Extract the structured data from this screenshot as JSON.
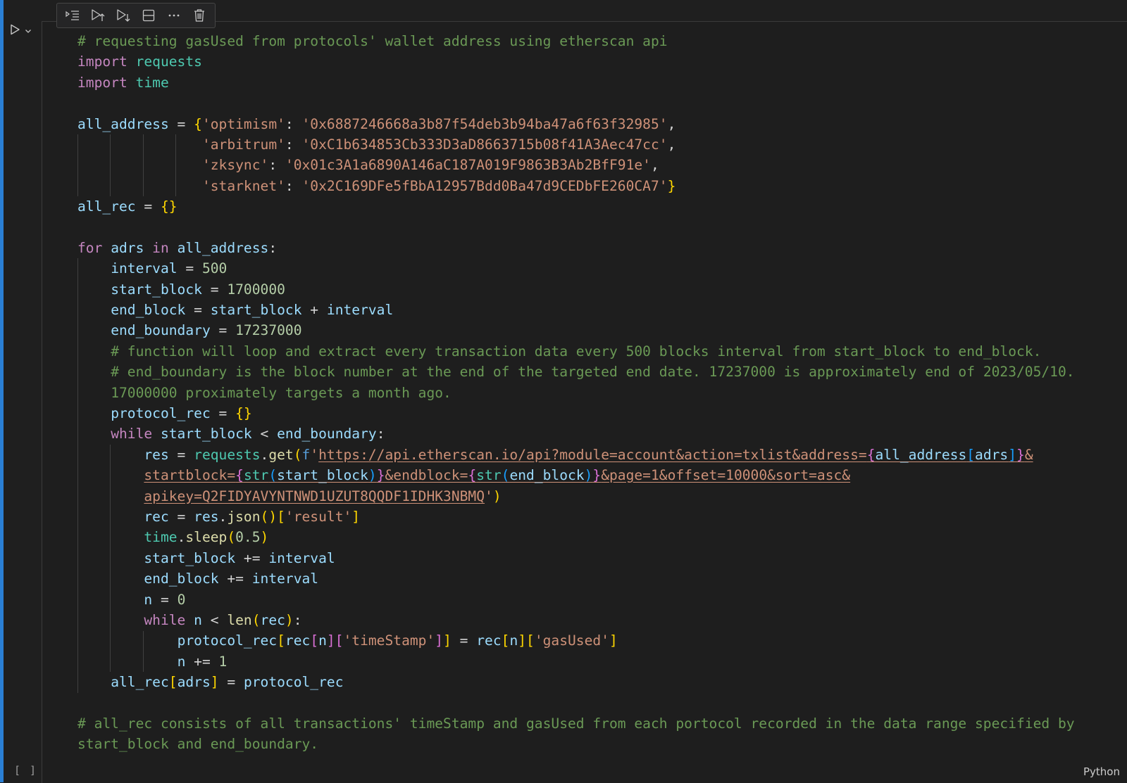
{
  "language": "Python",
  "execution_count": "[ ]",
  "colors": {
    "accent_bar": "#2a7fd4",
    "comment": "#6a9955",
    "keyword": "#c586c0",
    "string": "#ce9178",
    "variable": "#9cdcfe"
  },
  "toolbar": {
    "icons": [
      "execute-above-cells-icon",
      "execute-cell-and-below-icon",
      "run-below-icon",
      "split-cell-icon",
      "more-actions-icon",
      "delete-cell-icon"
    ]
  },
  "code_lines": [
    [
      [
        "cm",
        "# requesting gasUsed from protocols' wallet address using etherscan api"
      ]
    ],
    [
      [
        "kw",
        "import"
      ],
      [
        "op",
        " "
      ],
      [
        "mod",
        "requests"
      ]
    ],
    [
      [
        "kw",
        "import"
      ],
      [
        "op",
        " "
      ],
      [
        "mod",
        "time"
      ]
    ],
    [
      [
        "op",
        ""
      ]
    ],
    [
      [
        "var",
        "all_address"
      ],
      [
        "op",
        " = "
      ],
      [
        "b1",
        "{"
      ],
      [
        "str",
        "'optimism'"
      ],
      [
        "op",
        ": "
      ],
      [
        "str",
        "'0x6887246668a3b87f54deb3b94ba47a6f63f32985'"
      ],
      [
        "op",
        ","
      ]
    ],
    [
      [
        "op",
        "               "
      ],
      [
        "str",
        "'arbitrum'"
      ],
      [
        "op",
        ": "
      ],
      [
        "str",
        "'0xC1b634853Cb333D3aD8663715b08f41A3Aec47cc'"
      ],
      [
        "op",
        ","
      ]
    ],
    [
      [
        "op",
        "               "
      ],
      [
        "str",
        "'zksync'"
      ],
      [
        "op",
        ": "
      ],
      [
        "str",
        "'0x01c3A1a6890A146aC187A019F9863B3Ab2BfF91e'"
      ],
      [
        "op",
        ","
      ]
    ],
    [
      [
        "op",
        "               "
      ],
      [
        "str",
        "'starknet'"
      ],
      [
        "op",
        ": "
      ],
      [
        "str",
        "'0x2C169DFe5fBbA12957Bdd0Ba47d9CEDbFE260CA7'"
      ],
      [
        "b1",
        "}"
      ]
    ],
    [
      [
        "var",
        "all_rec"
      ],
      [
        "op",
        " = "
      ],
      [
        "b1",
        "{}"
      ]
    ],
    [
      [
        "op",
        ""
      ]
    ],
    [
      [
        "kw",
        "for"
      ],
      [
        "op",
        " "
      ],
      [
        "var",
        "adrs"
      ],
      [
        "op",
        " "
      ],
      [
        "kw",
        "in"
      ],
      [
        "op",
        " "
      ],
      [
        "var",
        "all_address"
      ],
      [
        "op",
        ":"
      ]
    ],
    [
      [
        "op",
        "    "
      ],
      [
        "var",
        "interval"
      ],
      [
        "op",
        " = "
      ],
      [
        "num",
        "500"
      ]
    ],
    [
      [
        "op",
        "    "
      ],
      [
        "var",
        "start_block"
      ],
      [
        "op",
        " = "
      ],
      [
        "num",
        "1700000"
      ]
    ],
    [
      [
        "op",
        "    "
      ],
      [
        "var",
        "end_block"
      ],
      [
        "op",
        " = "
      ],
      [
        "var",
        "start_block"
      ],
      [
        "op",
        " + "
      ],
      [
        "var",
        "interval"
      ]
    ],
    [
      [
        "op",
        "    "
      ],
      [
        "var",
        "end_boundary"
      ],
      [
        "op",
        " = "
      ],
      [
        "num",
        "17237000"
      ]
    ],
    [
      [
        "op",
        "    "
      ],
      [
        "cm",
        "# function will loop and extract every transaction data every 500 blocks interval from start_block to end_block."
      ]
    ],
    [
      [
        "op",
        "    "
      ],
      [
        "cm",
        "# end_boundary is the block number at the end of the targeted end date. 17237000 is approximately end of 2023/05/10."
      ]
    ],
    [
      [
        "op",
        "    "
      ],
      [
        "cm",
        "17000000 proximately targets a month ago."
      ]
    ],
    [
      [
        "op",
        "    "
      ],
      [
        "var",
        "protocol_rec"
      ],
      [
        "op",
        " = "
      ],
      [
        "b1",
        "{}"
      ]
    ],
    [
      [
        "op",
        "    "
      ],
      [
        "kw",
        "while"
      ],
      [
        "op",
        " "
      ],
      [
        "var",
        "start_block"
      ],
      [
        "op",
        " < "
      ],
      [
        "var",
        "end_boundary"
      ],
      [
        "op",
        ":"
      ]
    ],
    [
      [
        "op",
        "        "
      ],
      [
        "var",
        "res"
      ],
      [
        "op",
        " = "
      ],
      [
        "mod",
        "requests"
      ],
      [
        "op",
        "."
      ],
      [
        "fn",
        "get"
      ],
      [
        "b1",
        "("
      ],
      [
        "sf",
        "f"
      ],
      [
        "str",
        "'"
      ],
      [
        "str url",
        "https://api.etherscan.io/api?module=account&action=txlist&address="
      ],
      [
        "b2 url",
        "{"
      ],
      [
        "var url",
        "all_address"
      ],
      [
        "b3 url",
        "["
      ],
      [
        "var url",
        "adrs"
      ],
      [
        "b3 url",
        "]"
      ],
      [
        "b2 url",
        "}"
      ],
      [
        "str url",
        "&"
      ]
    ],
    [
      [
        "op",
        "        "
      ],
      [
        "str url",
        "startblock="
      ],
      [
        "b2 url",
        "{"
      ],
      [
        "bi url",
        "str"
      ],
      [
        "b3 url",
        "("
      ],
      [
        "var url",
        "start_block"
      ],
      [
        "b3 url",
        ")"
      ],
      [
        "b2 url",
        "}"
      ],
      [
        "str url",
        "&endblock="
      ],
      [
        "b2 url",
        "{"
      ],
      [
        "bi url",
        "str"
      ],
      [
        "b3 url",
        "("
      ],
      [
        "var url",
        "end_block"
      ],
      [
        "b3 url",
        ")"
      ],
      [
        "b2 url",
        "}"
      ],
      [
        "str url",
        "&page=1&offset=10000&sort=asc&"
      ]
    ],
    [
      [
        "op",
        "        "
      ],
      [
        "str url",
        "apikey=Q2FIDYAVYNTNWD1UZUT8QQDF1IDHK3NBMQ"
      ],
      [
        "str",
        "'"
      ],
      [
        "b1",
        ")"
      ]
    ],
    [
      [
        "op",
        "        "
      ],
      [
        "var",
        "rec"
      ],
      [
        "op",
        " = "
      ],
      [
        "var",
        "res"
      ],
      [
        "op",
        "."
      ],
      [
        "fn",
        "json"
      ],
      [
        "b1",
        "()"
      ],
      [
        "b1",
        "["
      ],
      [
        "str",
        "'result'"
      ],
      [
        "b1",
        "]"
      ]
    ],
    [
      [
        "op",
        "        "
      ],
      [
        "mod",
        "time"
      ],
      [
        "op",
        "."
      ],
      [
        "fn",
        "sleep"
      ],
      [
        "b1",
        "("
      ],
      [
        "num",
        "0.5"
      ],
      [
        "b1",
        ")"
      ]
    ],
    [
      [
        "op",
        "        "
      ],
      [
        "var",
        "start_block"
      ],
      [
        "op",
        " += "
      ],
      [
        "var",
        "interval"
      ]
    ],
    [
      [
        "op",
        "        "
      ],
      [
        "var",
        "end_block"
      ],
      [
        "op",
        " += "
      ],
      [
        "var",
        "interval"
      ]
    ],
    [
      [
        "op",
        "        "
      ],
      [
        "var",
        "n"
      ],
      [
        "op",
        " = "
      ],
      [
        "num",
        "0"
      ]
    ],
    [
      [
        "op",
        "        "
      ],
      [
        "kw",
        "while"
      ],
      [
        "op",
        " "
      ],
      [
        "var",
        "n"
      ],
      [
        "op",
        " < "
      ],
      [
        "fn",
        "len"
      ],
      [
        "b1",
        "("
      ],
      [
        "var",
        "rec"
      ],
      [
        "b1",
        ")"
      ],
      [
        "op",
        ":"
      ]
    ],
    [
      [
        "op",
        "            "
      ],
      [
        "var",
        "protocol_rec"
      ],
      [
        "b1",
        "["
      ],
      [
        "var",
        "rec"
      ],
      [
        "b2",
        "["
      ],
      [
        "var",
        "n"
      ],
      [
        "b2",
        "]"
      ],
      [
        "b2",
        "["
      ],
      [
        "str",
        "'timeStamp'"
      ],
      [
        "b2",
        "]"
      ],
      [
        "b1",
        "]"
      ],
      [
        "op",
        " = "
      ],
      [
        "var",
        "rec"
      ],
      [
        "b1",
        "["
      ],
      [
        "var",
        "n"
      ],
      [
        "b1",
        "]"
      ],
      [
        "b1",
        "["
      ],
      [
        "str",
        "'gasUsed'"
      ],
      [
        "b1",
        "]"
      ]
    ],
    [
      [
        "op",
        "            "
      ],
      [
        "var",
        "n"
      ],
      [
        "op",
        " += "
      ],
      [
        "num",
        "1"
      ]
    ],
    [
      [
        "op",
        "    "
      ],
      [
        "var",
        "all_rec"
      ],
      [
        "b1",
        "["
      ],
      [
        "var",
        "adrs"
      ],
      [
        "b1",
        "]"
      ],
      [
        "op",
        " = "
      ],
      [
        "var",
        "protocol_rec"
      ]
    ],
    [
      [
        "op",
        ""
      ]
    ],
    [
      [
        "cm",
        "# all_rec consists of all transactions' timeStamp and gasUsed from each portocol recorded in the data range specified by"
      ]
    ],
    [
      [
        "cm",
        "start_block and end_boundary."
      ]
    ]
  ]
}
